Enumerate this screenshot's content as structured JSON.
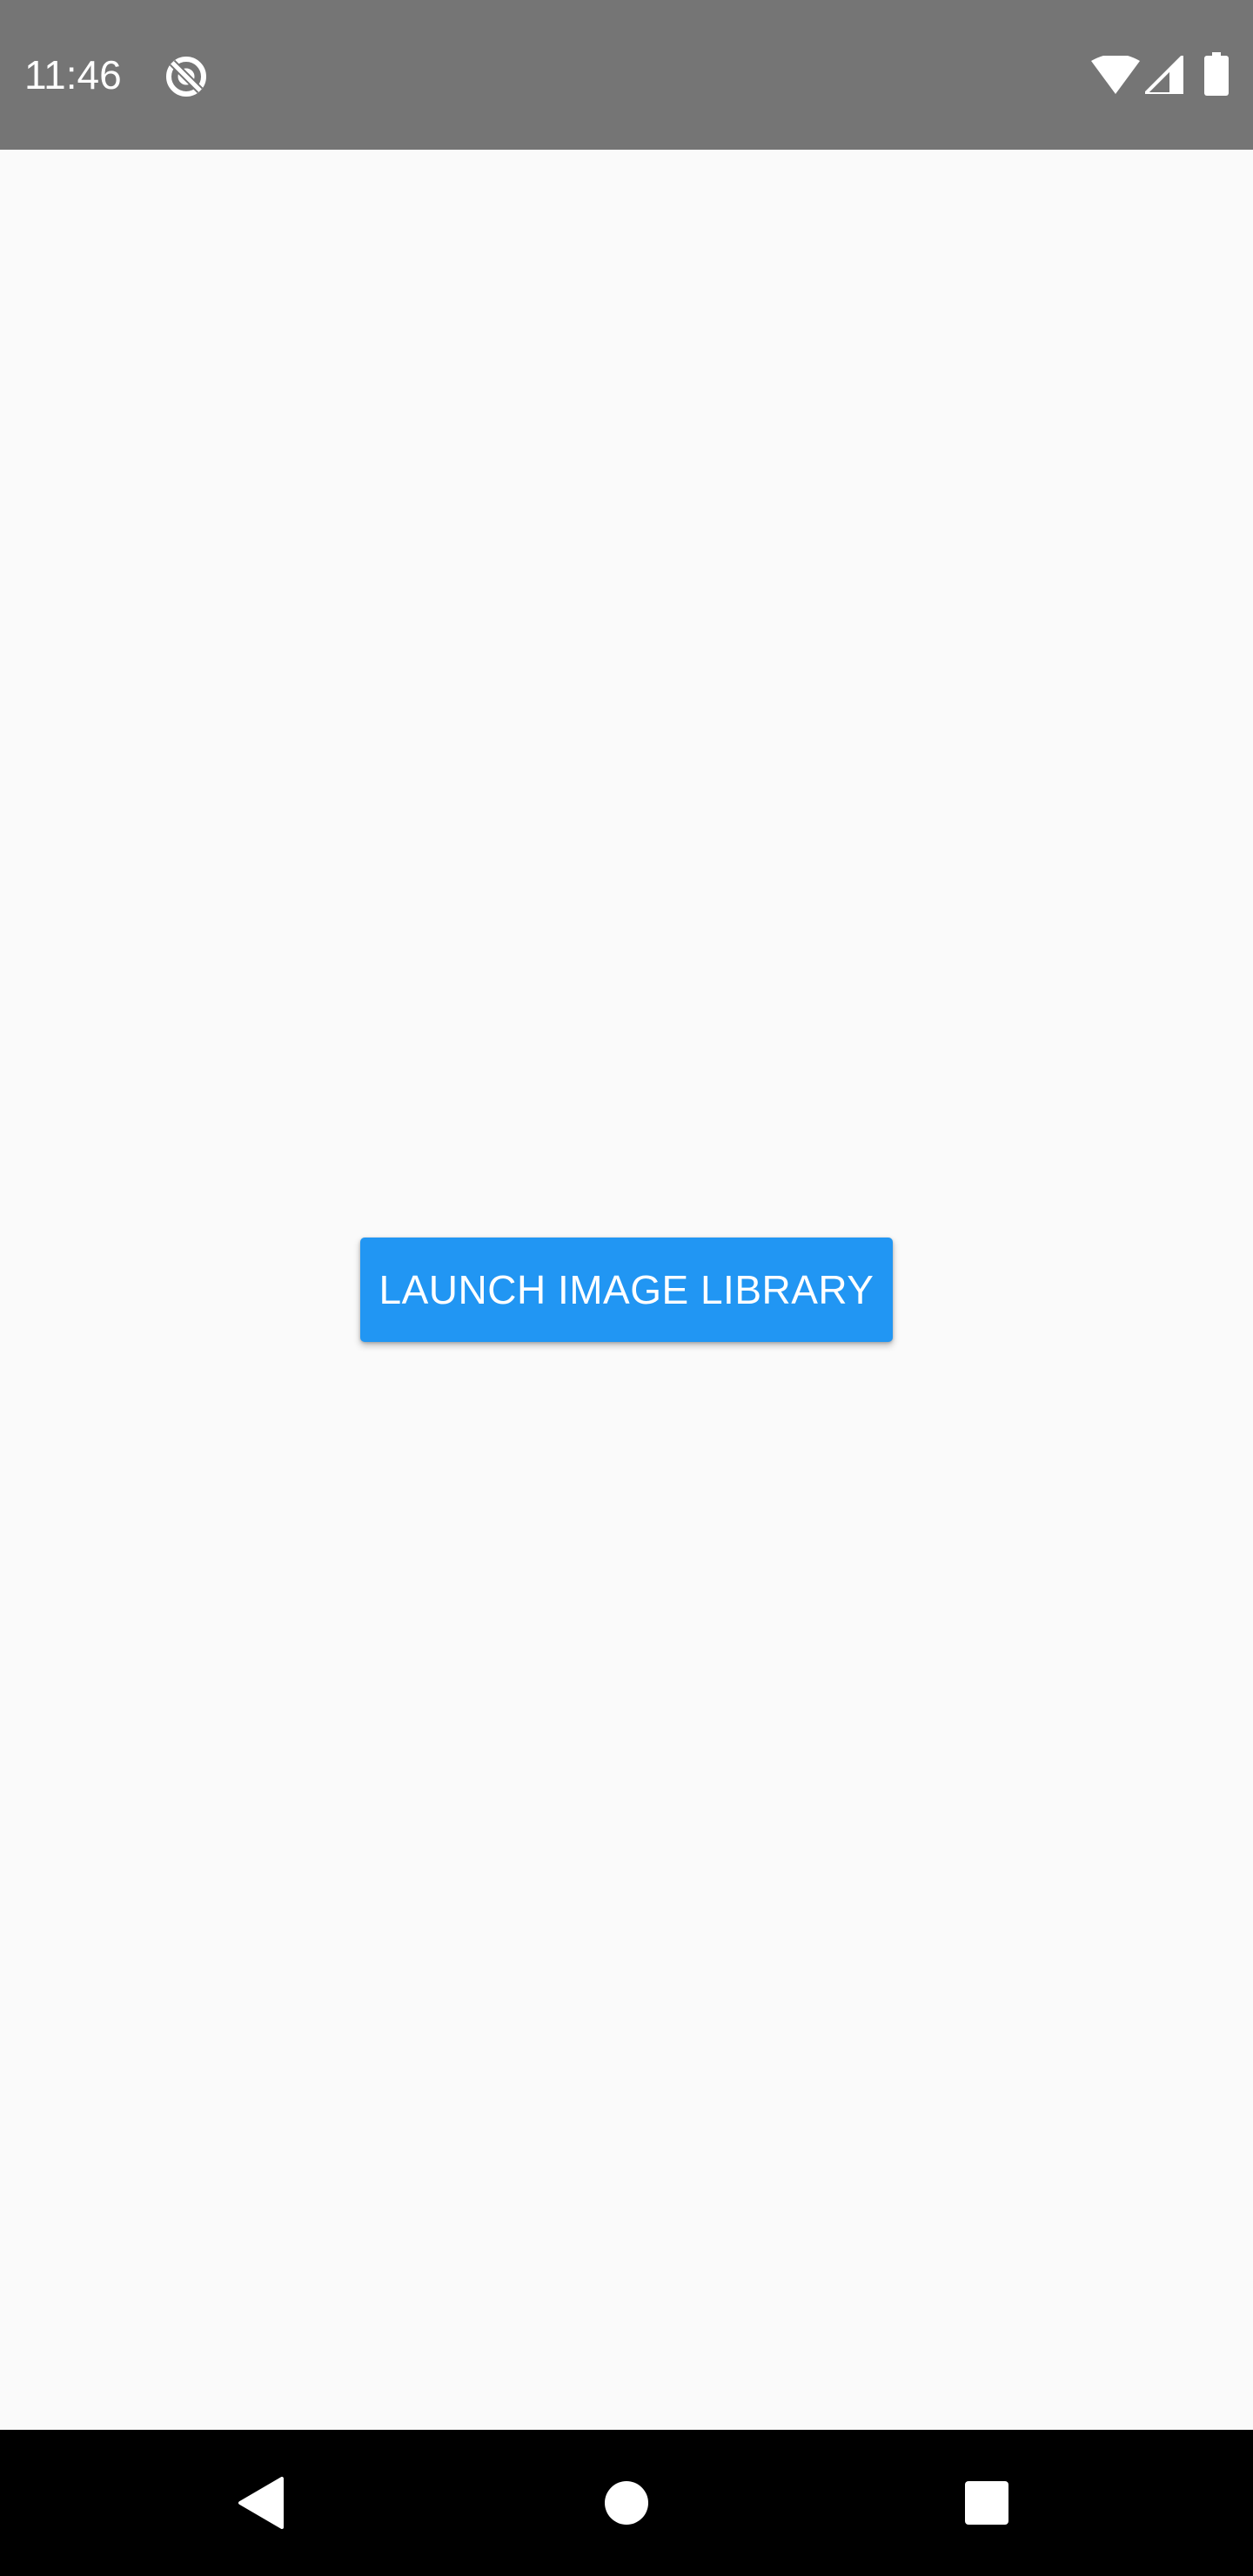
{
  "status_bar": {
    "time": "11:46",
    "icons": [
      "sync-disabled-icon",
      "wifi-icon",
      "cellular-signal-icon",
      "battery-icon"
    ],
    "background_color": "#757575"
  },
  "main": {
    "launch_button_label": "LAUNCH IMAGE LIBRARY",
    "button_color": "#2196f3",
    "background_color": "#fafafa"
  },
  "nav_bar": {
    "buttons": [
      "back-icon",
      "home-icon",
      "recents-icon"
    ],
    "background_color": "#000000"
  }
}
